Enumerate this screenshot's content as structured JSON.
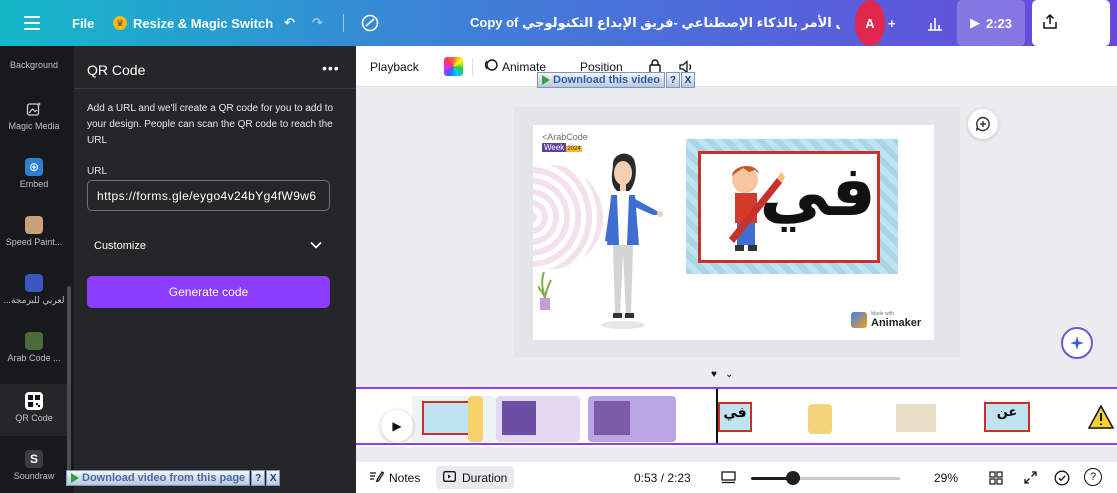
{
  "topbar": {
    "file": "File",
    "resize": "Resize & Magic Switch",
    "title": "شرح فعل الأمر بالذكاء الإصطناعي -فريق الإبداع التكنولوجي Copy of",
    "avatar": "A",
    "present": "2:23",
    "share": "Share",
    "colors": {
      "accent": "#8b3dff",
      "avatar": "#e0284e"
    }
  },
  "rail": {
    "items": [
      {
        "label": "Background"
      },
      {
        "label": "Magic Media",
        "icon": "magic-media-icon"
      },
      {
        "label": "Embed",
        "icon": "embed-icon"
      },
      {
        "label": "Speed Paint..."
      },
      {
        "label": "...لعربي للبرمجة"
      },
      {
        "label": "Arab Code ..."
      },
      {
        "label": "QR Code",
        "icon": "qr-code-icon"
      },
      {
        "label": "Soundraw"
      }
    ]
  },
  "panel": {
    "title": "QR Code",
    "more": "•••",
    "description": "Add a URL and we'll create a QR code for you to add to your design. People can scan the QR code to reach the URL",
    "url_label": "URL",
    "url_value": "https://forms.gle/eygo4v24bYg4fW9w6",
    "customize": "Customize",
    "generate": "Generate code"
  },
  "downloads": {
    "top": "Download this video",
    "bottom": "Download video from this page",
    "q": "?",
    "x": "X"
  },
  "editor_toolbar": {
    "playback": "Playback",
    "animate": "Animate",
    "position": "Position"
  },
  "slide": {
    "logo_top": "<ArabCode",
    "logo_week": "Week",
    "logo_year": "2024",
    "letter": "في",
    "brand_small": "Made with",
    "brand": "Animaker"
  },
  "timeline": {
    "clip_letter_1": "في",
    "clip_letter_2": "عن"
  },
  "footer": {
    "notes": "Notes",
    "duration": "Duration",
    "time": "0:53 / 2:23",
    "zoom": "29%",
    "help": "?"
  }
}
